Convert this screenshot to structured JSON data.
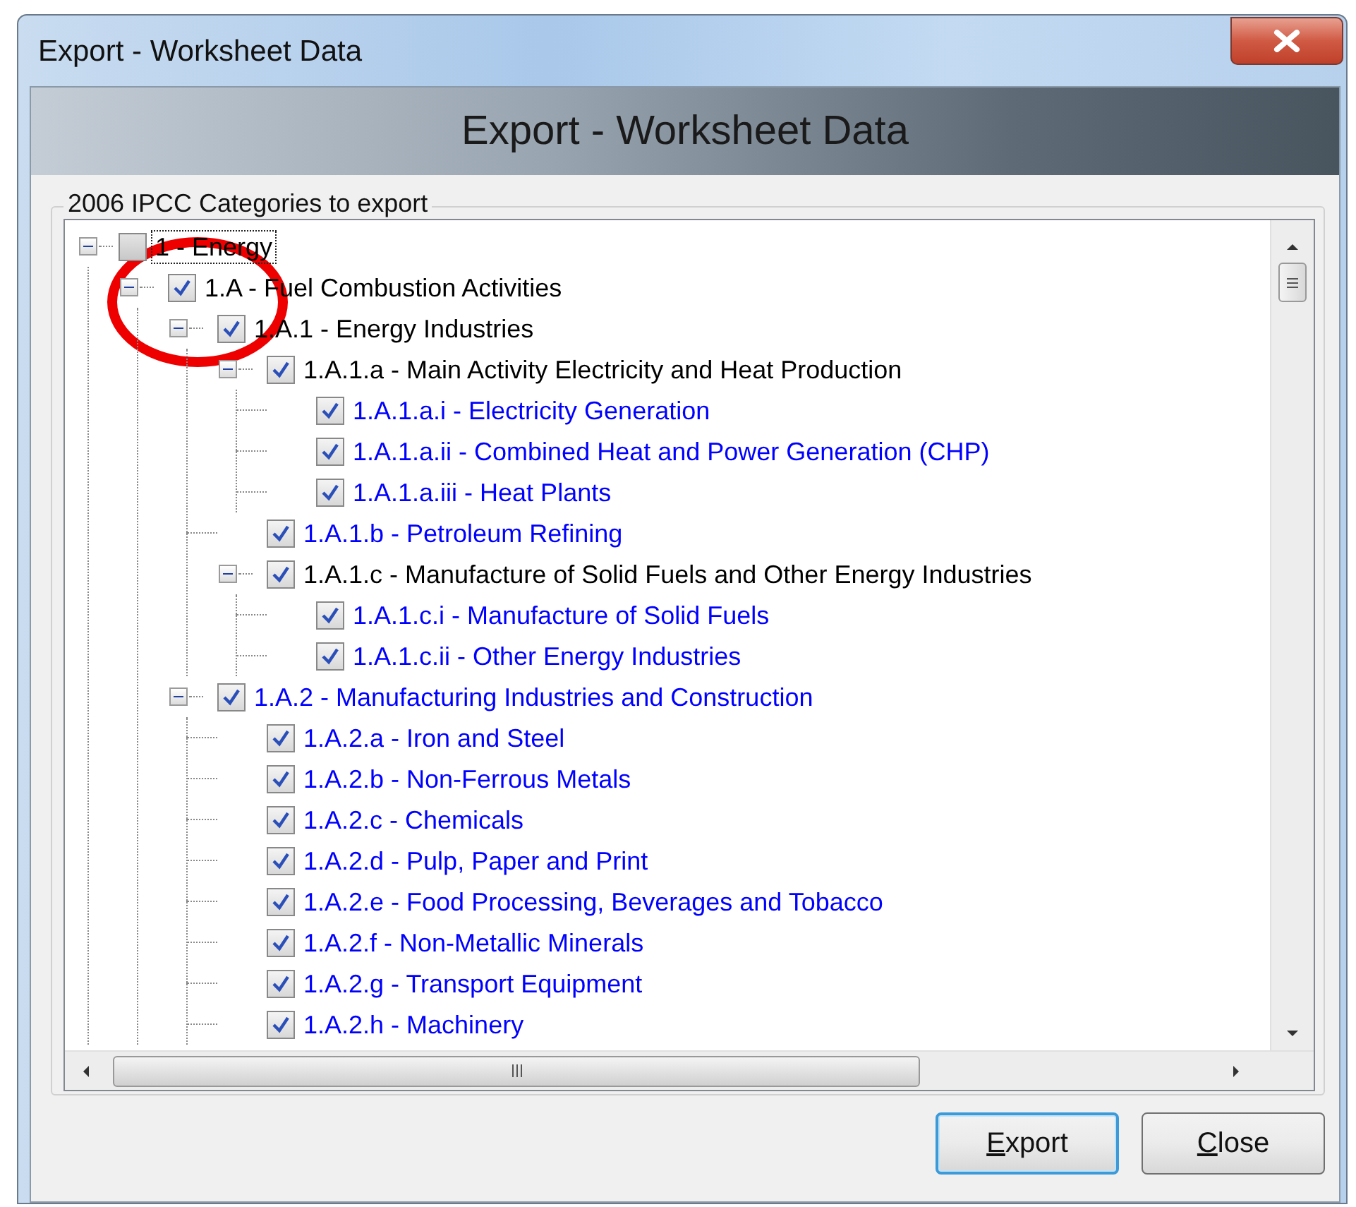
{
  "window": {
    "title": "Export - Worksheet Data"
  },
  "header": {
    "title": "Export - Worksheet Data"
  },
  "group": {
    "label": "2006 IPCC Categories to export"
  },
  "annotations": [
    {
      "kind": "circle"
    }
  ],
  "tree": [
    {
      "label": "1 - Energy",
      "checked": false,
      "expanded": true,
      "selected": true,
      "color": "#000000",
      "children": [
        {
          "label": "1.A - Fuel Combustion Activities",
          "checked": true,
          "expanded": true,
          "selected": false,
          "color": "#000000",
          "children": [
            {
              "label": "1.A.1 - Energy Industries",
              "checked": true,
              "expanded": true,
              "selected": false,
              "color": "#000000",
              "children": [
                {
                  "label": "1.A.1.a - Main Activity Electricity and Heat Production",
                  "checked": true,
                  "expanded": true,
                  "selected": false,
                  "color": "#000000",
                  "children": [
                    {
                      "label": "1.A.1.a.i - Electricity Generation",
                      "checked": true,
                      "selected": false,
                      "color": "#0000ff"
                    },
                    {
                      "label": "1.A.1.a.ii - Combined Heat and Power Generation (CHP)",
                      "checked": true,
                      "selected": false,
                      "color": "#0000ff"
                    },
                    {
                      "label": "1.A.1.a.iii - Heat Plants",
                      "checked": true,
                      "selected": false,
                      "color": "#0000ff"
                    }
                  ]
                },
                {
                  "label": "1.A.1.b - Petroleum Refining",
                  "checked": true,
                  "selected": false,
                  "color": "#0000ff"
                },
                {
                  "label": "1.A.1.c - Manufacture of Solid Fuels and Other Energy Industries",
                  "checked": true,
                  "expanded": true,
                  "selected": false,
                  "color": "#000000",
                  "children": [
                    {
                      "label": "1.A.1.c.i - Manufacture of Solid Fuels",
                      "checked": true,
                      "selected": false,
                      "color": "#0000ff"
                    },
                    {
                      "label": "1.A.1.c.ii - Other Energy Industries",
                      "checked": true,
                      "selected": false,
                      "color": "#0000ff"
                    }
                  ]
                }
              ]
            },
            {
              "label": "1.A.2 - Manufacturing Industries and Construction",
              "checked": true,
              "expanded": true,
              "selected": false,
              "color": "#0000ff",
              "children": [
                {
                  "label": "1.A.2.a - Iron and Steel",
                  "checked": true,
                  "selected": false,
                  "color": "#0000ff"
                },
                {
                  "label": "1.A.2.b - Non-Ferrous Metals",
                  "checked": true,
                  "selected": false,
                  "color": "#0000ff"
                },
                {
                  "label": "1.A.2.c - Chemicals",
                  "checked": true,
                  "selected": false,
                  "color": "#0000ff"
                },
                {
                  "label": "1.A.2.d - Pulp, Paper and Print",
                  "checked": true,
                  "selected": false,
                  "color": "#0000ff"
                },
                {
                  "label": "1.A.2.e - Food Processing, Beverages and Tobacco",
                  "checked": true,
                  "selected": false,
                  "color": "#0000ff"
                },
                {
                  "label": "1.A.2.f - Non-Metallic Minerals",
                  "checked": true,
                  "selected": false,
                  "color": "#0000ff"
                },
                {
                  "label": "1.A.2.g - Transport Equipment",
                  "checked": true,
                  "selected": false,
                  "color": "#0000ff"
                },
                {
                  "label": "1.A.2.h - Machinery",
                  "checked": true,
                  "selected": false,
                  "color": "#0000ff"
                }
              ]
            }
          ]
        }
      ]
    }
  ],
  "buttons": [
    {
      "label": "Export",
      "default": true,
      "underline_first": true
    },
    {
      "label": "Close",
      "default": false,
      "underline_first": true
    }
  ]
}
